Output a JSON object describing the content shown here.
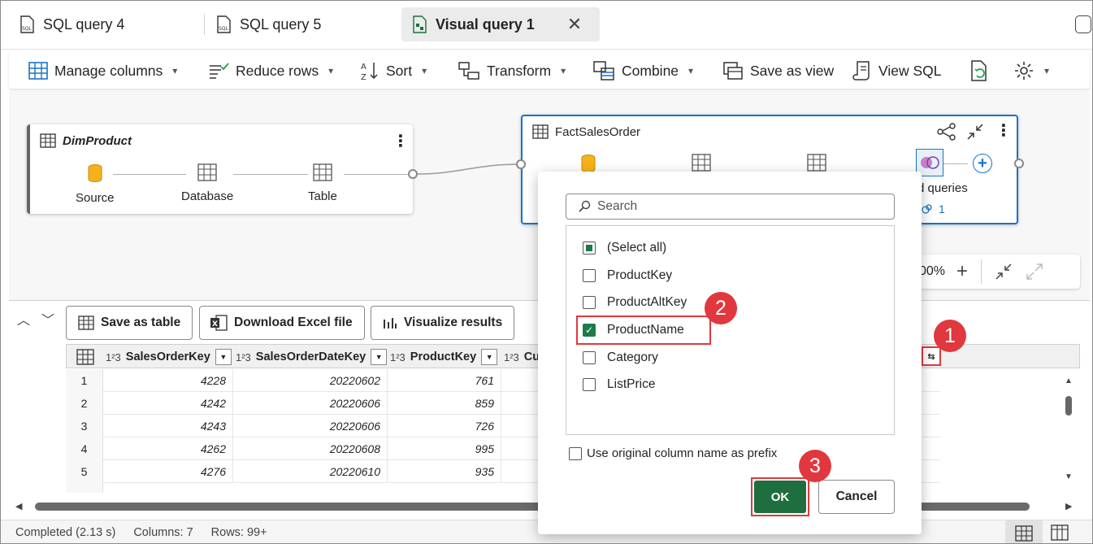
{
  "tabs": [
    {
      "label": "SQL query 4",
      "icon": "sql-file-icon",
      "active": false
    },
    {
      "label": "SQL query 5",
      "icon": "sql-file-icon",
      "active": false
    },
    {
      "label": "Visual query 1",
      "icon": "visual-query-icon",
      "active": true
    }
  ],
  "toolbar": {
    "manage_columns": "Manage columns",
    "reduce_rows": "Reduce rows",
    "sort": "Sort",
    "transform": "Transform",
    "combine": "Combine",
    "save_as_view": "Save as view",
    "view_sql": "View SQL"
  },
  "canvas": {
    "dim_product": {
      "title": "DimProduct",
      "steps": [
        "Source",
        "Database",
        "Table"
      ]
    },
    "fact_sales": {
      "title": "FactSalesOrder",
      "step_partial": "d queries",
      "step_count": "1"
    },
    "zoom_partial": "00%"
  },
  "actions": {
    "save_as_table": "Save as table",
    "download_excel": "Download Excel file",
    "visualize": "Visualize results"
  },
  "grid": {
    "columns": [
      {
        "type": "1²3",
        "name": "SalesOrderKey"
      },
      {
        "type": "1²3",
        "name": "SalesOrderDateKey"
      },
      {
        "type": "1²3",
        "name": "ProductKey"
      },
      {
        "type": "1²3",
        "name": "Cu"
      }
    ],
    "rows": [
      {
        "n": "1",
        "a": "4228",
        "b": "20220602",
        "c": "761"
      },
      {
        "n": "2",
        "a": "4242",
        "b": "20220606",
        "c": "859"
      },
      {
        "n": "3",
        "a": "4243",
        "b": "20220606",
        "c": "726"
      },
      {
        "n": "4",
        "a": "4262",
        "b": "20220608",
        "c": "995"
      },
      {
        "n": "5",
        "a": "4276",
        "b": "20220610",
        "c": "935"
      }
    ]
  },
  "filter_panel": {
    "search_placeholder": "Search",
    "options": [
      {
        "label": "(Select all)",
        "state": "partial"
      },
      {
        "label": "ProductKey",
        "state": "unchecked"
      },
      {
        "label": "ProductAltKey",
        "state": "unchecked"
      },
      {
        "label": "ProductName",
        "state": "checked"
      },
      {
        "label": "Category",
        "state": "unchecked"
      },
      {
        "label": "ListPrice",
        "state": "unchecked"
      }
    ],
    "prefix_label": "Use original column name as prefix",
    "ok": "OK",
    "cancel": "Cancel"
  },
  "callouts": [
    "1",
    "2",
    "3"
  ],
  "status": {
    "completed": "Completed (2.13 s)",
    "columns": "Columns: 7",
    "rows": "Rows: 99+"
  },
  "colors": {
    "accent_green": "#1e6e3f",
    "highlight_red": "#e0383e",
    "selection_blue": "#1a73c8"
  }
}
